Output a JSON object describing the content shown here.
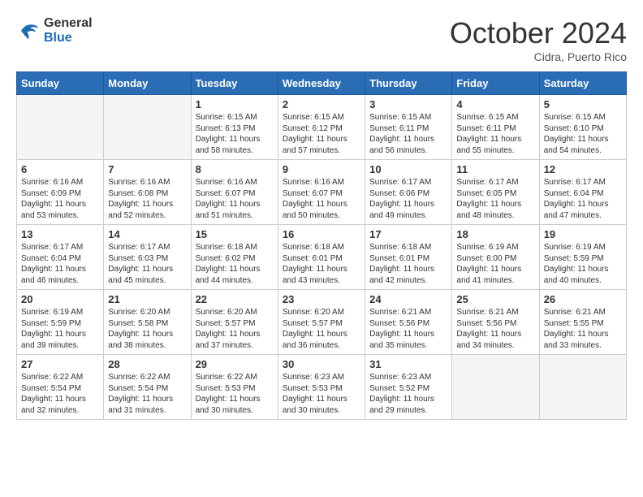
{
  "header": {
    "logo_line1": "General",
    "logo_line2": "Blue",
    "month": "October 2024",
    "location": "Cidra, Puerto Rico"
  },
  "weekdays": [
    "Sunday",
    "Monday",
    "Tuesday",
    "Wednesday",
    "Thursday",
    "Friday",
    "Saturday"
  ],
  "weeks": [
    [
      {
        "day": "",
        "info": ""
      },
      {
        "day": "",
        "info": ""
      },
      {
        "day": "1",
        "info": "Sunrise: 6:15 AM\nSunset: 6:13 PM\nDaylight: 11 hours and 58 minutes."
      },
      {
        "day": "2",
        "info": "Sunrise: 6:15 AM\nSunset: 6:12 PM\nDaylight: 11 hours and 57 minutes."
      },
      {
        "day": "3",
        "info": "Sunrise: 6:15 AM\nSunset: 6:11 PM\nDaylight: 11 hours and 56 minutes."
      },
      {
        "day": "4",
        "info": "Sunrise: 6:15 AM\nSunset: 6:11 PM\nDaylight: 11 hours and 55 minutes."
      },
      {
        "day": "5",
        "info": "Sunrise: 6:15 AM\nSunset: 6:10 PM\nDaylight: 11 hours and 54 minutes."
      }
    ],
    [
      {
        "day": "6",
        "info": "Sunrise: 6:16 AM\nSunset: 6:09 PM\nDaylight: 11 hours and 53 minutes."
      },
      {
        "day": "7",
        "info": "Sunrise: 6:16 AM\nSunset: 6:08 PM\nDaylight: 11 hours and 52 minutes."
      },
      {
        "day": "8",
        "info": "Sunrise: 6:16 AM\nSunset: 6:07 PM\nDaylight: 11 hours and 51 minutes."
      },
      {
        "day": "9",
        "info": "Sunrise: 6:16 AM\nSunset: 6:07 PM\nDaylight: 11 hours and 50 minutes."
      },
      {
        "day": "10",
        "info": "Sunrise: 6:17 AM\nSunset: 6:06 PM\nDaylight: 11 hours and 49 minutes."
      },
      {
        "day": "11",
        "info": "Sunrise: 6:17 AM\nSunset: 6:05 PM\nDaylight: 11 hours and 48 minutes."
      },
      {
        "day": "12",
        "info": "Sunrise: 6:17 AM\nSunset: 6:04 PM\nDaylight: 11 hours and 47 minutes."
      }
    ],
    [
      {
        "day": "13",
        "info": "Sunrise: 6:17 AM\nSunset: 6:04 PM\nDaylight: 11 hours and 46 minutes."
      },
      {
        "day": "14",
        "info": "Sunrise: 6:17 AM\nSunset: 6:03 PM\nDaylight: 11 hours and 45 minutes."
      },
      {
        "day": "15",
        "info": "Sunrise: 6:18 AM\nSunset: 6:02 PM\nDaylight: 11 hours and 44 minutes."
      },
      {
        "day": "16",
        "info": "Sunrise: 6:18 AM\nSunset: 6:01 PM\nDaylight: 11 hours and 43 minutes."
      },
      {
        "day": "17",
        "info": "Sunrise: 6:18 AM\nSunset: 6:01 PM\nDaylight: 11 hours and 42 minutes."
      },
      {
        "day": "18",
        "info": "Sunrise: 6:19 AM\nSunset: 6:00 PM\nDaylight: 11 hours and 41 minutes."
      },
      {
        "day": "19",
        "info": "Sunrise: 6:19 AM\nSunset: 5:59 PM\nDaylight: 11 hours and 40 minutes."
      }
    ],
    [
      {
        "day": "20",
        "info": "Sunrise: 6:19 AM\nSunset: 5:59 PM\nDaylight: 11 hours and 39 minutes."
      },
      {
        "day": "21",
        "info": "Sunrise: 6:20 AM\nSunset: 5:58 PM\nDaylight: 11 hours and 38 minutes."
      },
      {
        "day": "22",
        "info": "Sunrise: 6:20 AM\nSunset: 5:57 PM\nDaylight: 11 hours and 37 minutes."
      },
      {
        "day": "23",
        "info": "Sunrise: 6:20 AM\nSunset: 5:57 PM\nDaylight: 11 hours and 36 minutes."
      },
      {
        "day": "24",
        "info": "Sunrise: 6:21 AM\nSunset: 5:56 PM\nDaylight: 11 hours and 35 minutes."
      },
      {
        "day": "25",
        "info": "Sunrise: 6:21 AM\nSunset: 5:56 PM\nDaylight: 11 hours and 34 minutes."
      },
      {
        "day": "26",
        "info": "Sunrise: 6:21 AM\nSunset: 5:55 PM\nDaylight: 11 hours and 33 minutes."
      }
    ],
    [
      {
        "day": "27",
        "info": "Sunrise: 6:22 AM\nSunset: 5:54 PM\nDaylight: 11 hours and 32 minutes."
      },
      {
        "day": "28",
        "info": "Sunrise: 6:22 AM\nSunset: 5:54 PM\nDaylight: 11 hours and 31 minutes."
      },
      {
        "day": "29",
        "info": "Sunrise: 6:22 AM\nSunset: 5:53 PM\nDaylight: 11 hours and 30 minutes."
      },
      {
        "day": "30",
        "info": "Sunrise: 6:23 AM\nSunset: 5:53 PM\nDaylight: 11 hours and 30 minutes."
      },
      {
        "day": "31",
        "info": "Sunrise: 6:23 AM\nSunset: 5:52 PM\nDaylight: 11 hours and 29 minutes."
      },
      {
        "day": "",
        "info": ""
      },
      {
        "day": "",
        "info": ""
      }
    ]
  ]
}
